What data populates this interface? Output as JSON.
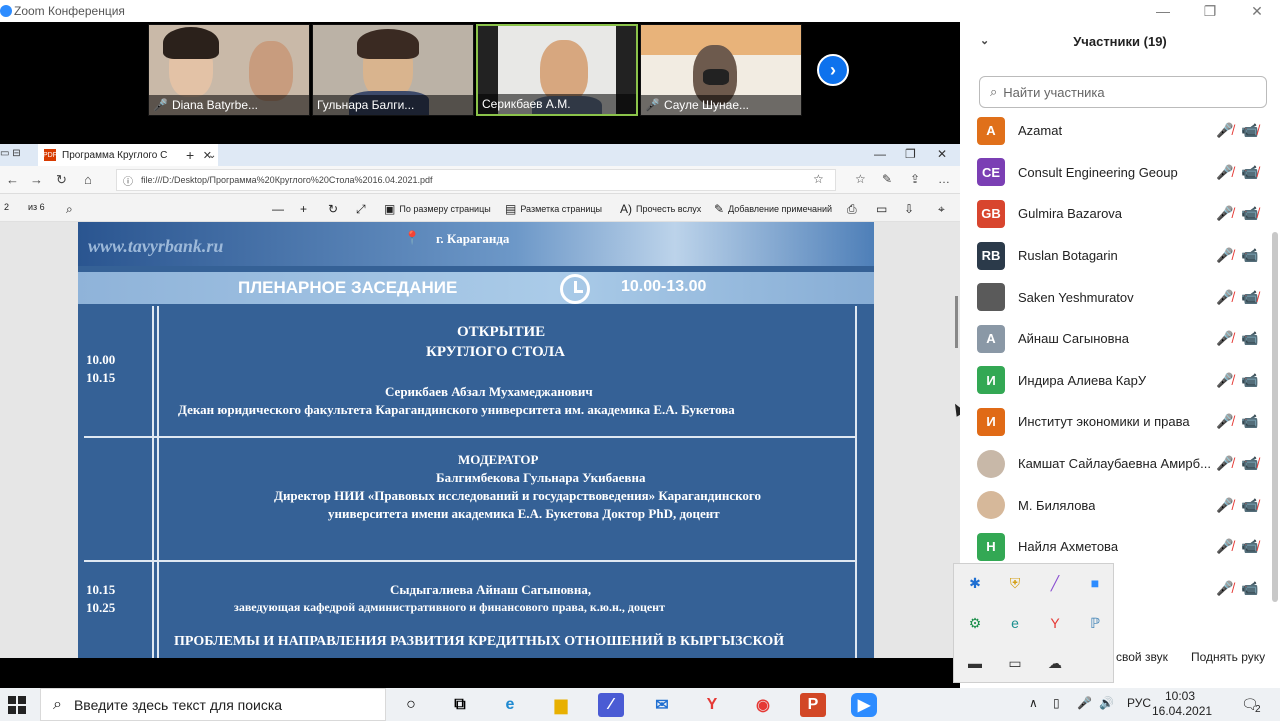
{
  "zoom": {
    "title": "Zoom Конференция",
    "controls": [
      "—",
      "❐",
      "✕"
    ]
  },
  "video_tiles": [
    {
      "name": "Diana Batyrbe...",
      "muted": true,
      "bg": "#c9b9a8",
      "face": "#e3c2a6"
    },
    {
      "name": "Гульнара Балги...",
      "muted": false,
      "bg": "#bbb2a6",
      "face": "#d9b48e"
    },
    {
      "name": "Серикбаев А.М.",
      "muted": false,
      "bg": "#e8e8e6",
      "face": "#d7a77f"
    },
    {
      "name": "Сауле Шунае...",
      "muted": true,
      "bg": "#f2ece2",
      "face": "#6d5a4d"
    }
  ],
  "browser": {
    "tab_title": "Программа Круглого С",
    "url": "file:///D:/Desktop/Программа%20Круглого%20Стола%2016.04.2021.pdf",
    "page_current": "2",
    "page_total": "из 6",
    "toolbar": {
      "fit": "По размеру страницы",
      "layout": "Разметка страницы",
      "read_aloud": "Прочесть вслух",
      "annotate": "Добавление примечаний"
    }
  },
  "pdf": {
    "website": "www.tavyrbank.ru",
    "city": "г. Караганда",
    "session": "ПЛЕНАРНОЕ ЗАСЕДАНИЕ",
    "session_time": "10.00-13.00",
    "row1": {
      "t1": "10.00",
      "t2": "10.15",
      "title1": "ОТКРЫТИЕ",
      "title2": "КРУГЛОГО СТОЛА",
      "speaker": "Серикбаев Абзал Мухамеджанович",
      "role": "Декан  юридического факультета Карагандинского  университета им. академика Е.А. Букетова"
    },
    "row2": {
      "title": "МОДЕРАТОР",
      "speaker": "Балгимбекова Гульнара Укибаевна",
      "role1": "Директор НИИ «Правовых исследований и государствоведения» Карагандинского",
      "role2": "университета имени  академика Е.А. Букетова  Доктор PhD, доцент"
    },
    "row3": {
      "t1": "10.15",
      "t2": "10.25",
      "speaker": "Сыдыгалиева Айнаш Сагыновна,",
      "role": "заведующая кафедрой административного и финансового права, к.ю.н., доцент",
      "topic": "ПРОБЛЕМЫ И НАПРАВЛЕНИЯ РАЗВИТИЯ КРЕДИТНЫХ ОТНОШЕНИЙ В КЫРГЫЗСКОЙ"
    }
  },
  "participants": {
    "header": "Участники (19)",
    "search_placeholder": "Найти участника",
    "list": [
      {
        "initials": "A",
        "name": "Azamat",
        "color": "#e0701a",
        "video": false
      },
      {
        "initials": "CE",
        "name": "Consult Engineering Geoup",
        "color": "#7b3fb4",
        "video": false
      },
      {
        "initials": "GB",
        "name": "Gulmira Bazarova",
        "color": "#d8452e",
        "video": false
      },
      {
        "initials": "RB",
        "name": "Ruslan Botagarin",
        "color": "#2b3a4a",
        "video": true
      },
      {
        "initials": "",
        "name": "Saken Yeshmuratov",
        "color": "#5a5a5a",
        "video": false
      },
      {
        "initials": "А",
        "name": "Айнаш Сагыновна",
        "color": "#8a98a6",
        "video": true
      },
      {
        "initials": "И",
        "name": "Индира Алиева КарУ",
        "color": "#33a854",
        "video": true
      },
      {
        "initials": "И",
        "name": "Институт экономики и права",
        "color": "#e06a16",
        "video": true
      },
      {
        "initials": "",
        "name": "Камшат Сайлаубаевна Амирб...",
        "color": "#c8b8a8",
        "video": false
      },
      {
        "initials": "",
        "name": "М. Билялова",
        "color": "#d6b89a",
        "video": false
      },
      {
        "initials": "Н",
        "name": "Найля Ахметова",
        "color": "#33a854",
        "video": false
      },
      {
        "initials": "",
        "name": "",
        "color": "#ffffff",
        "video": true
      }
    ],
    "footer": {
      "mute_all": "свой звук",
      "raise_hand": "Поднять руку"
    }
  },
  "taskbar": {
    "search_placeholder": "Введите здесь текст для поиска",
    "lang": "РУС",
    "time": "10:03",
    "date": "16.04.2021",
    "notifications": "2"
  }
}
